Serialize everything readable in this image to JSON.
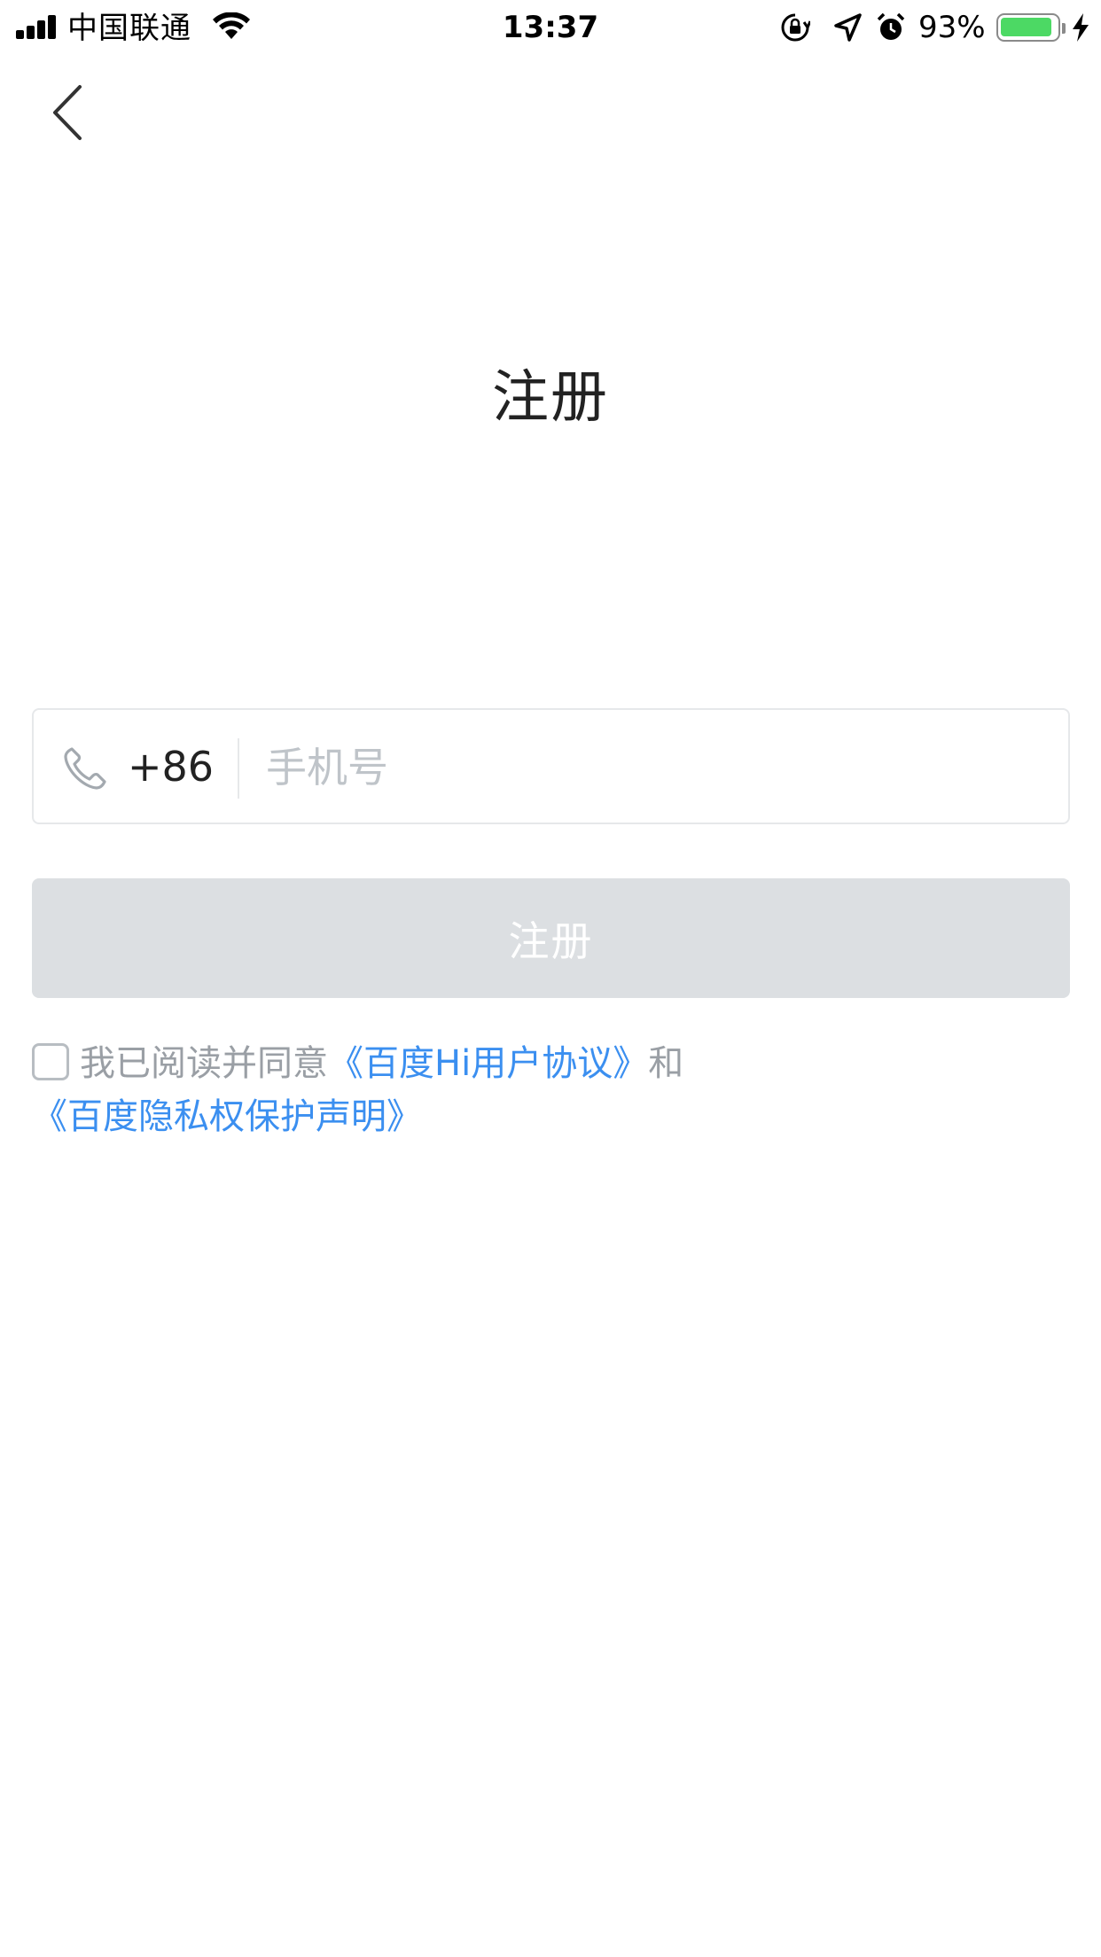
{
  "status_bar": {
    "carrier": "中国联通",
    "time": "13:37",
    "battery_percent": "93%",
    "battery_level": 0.93,
    "battery_color": "#4cd964"
  },
  "nav": {
    "back_icon": "chevron-left-icon"
  },
  "page": {
    "title": "注册"
  },
  "phone_field": {
    "icon": "phone-icon",
    "country_code": "+86",
    "placeholder": "手机号",
    "value": ""
  },
  "register_button": {
    "label": "注册",
    "background": "#dcdfe2"
  },
  "agreement": {
    "prefix": "我已阅读并同意",
    "user_agreement_link": "《百度Hi用户协议》",
    "conjunction": "和",
    "privacy_link": "《百度隐私权保护声明》",
    "link_color": "#3b8ff0",
    "checked": false
  }
}
